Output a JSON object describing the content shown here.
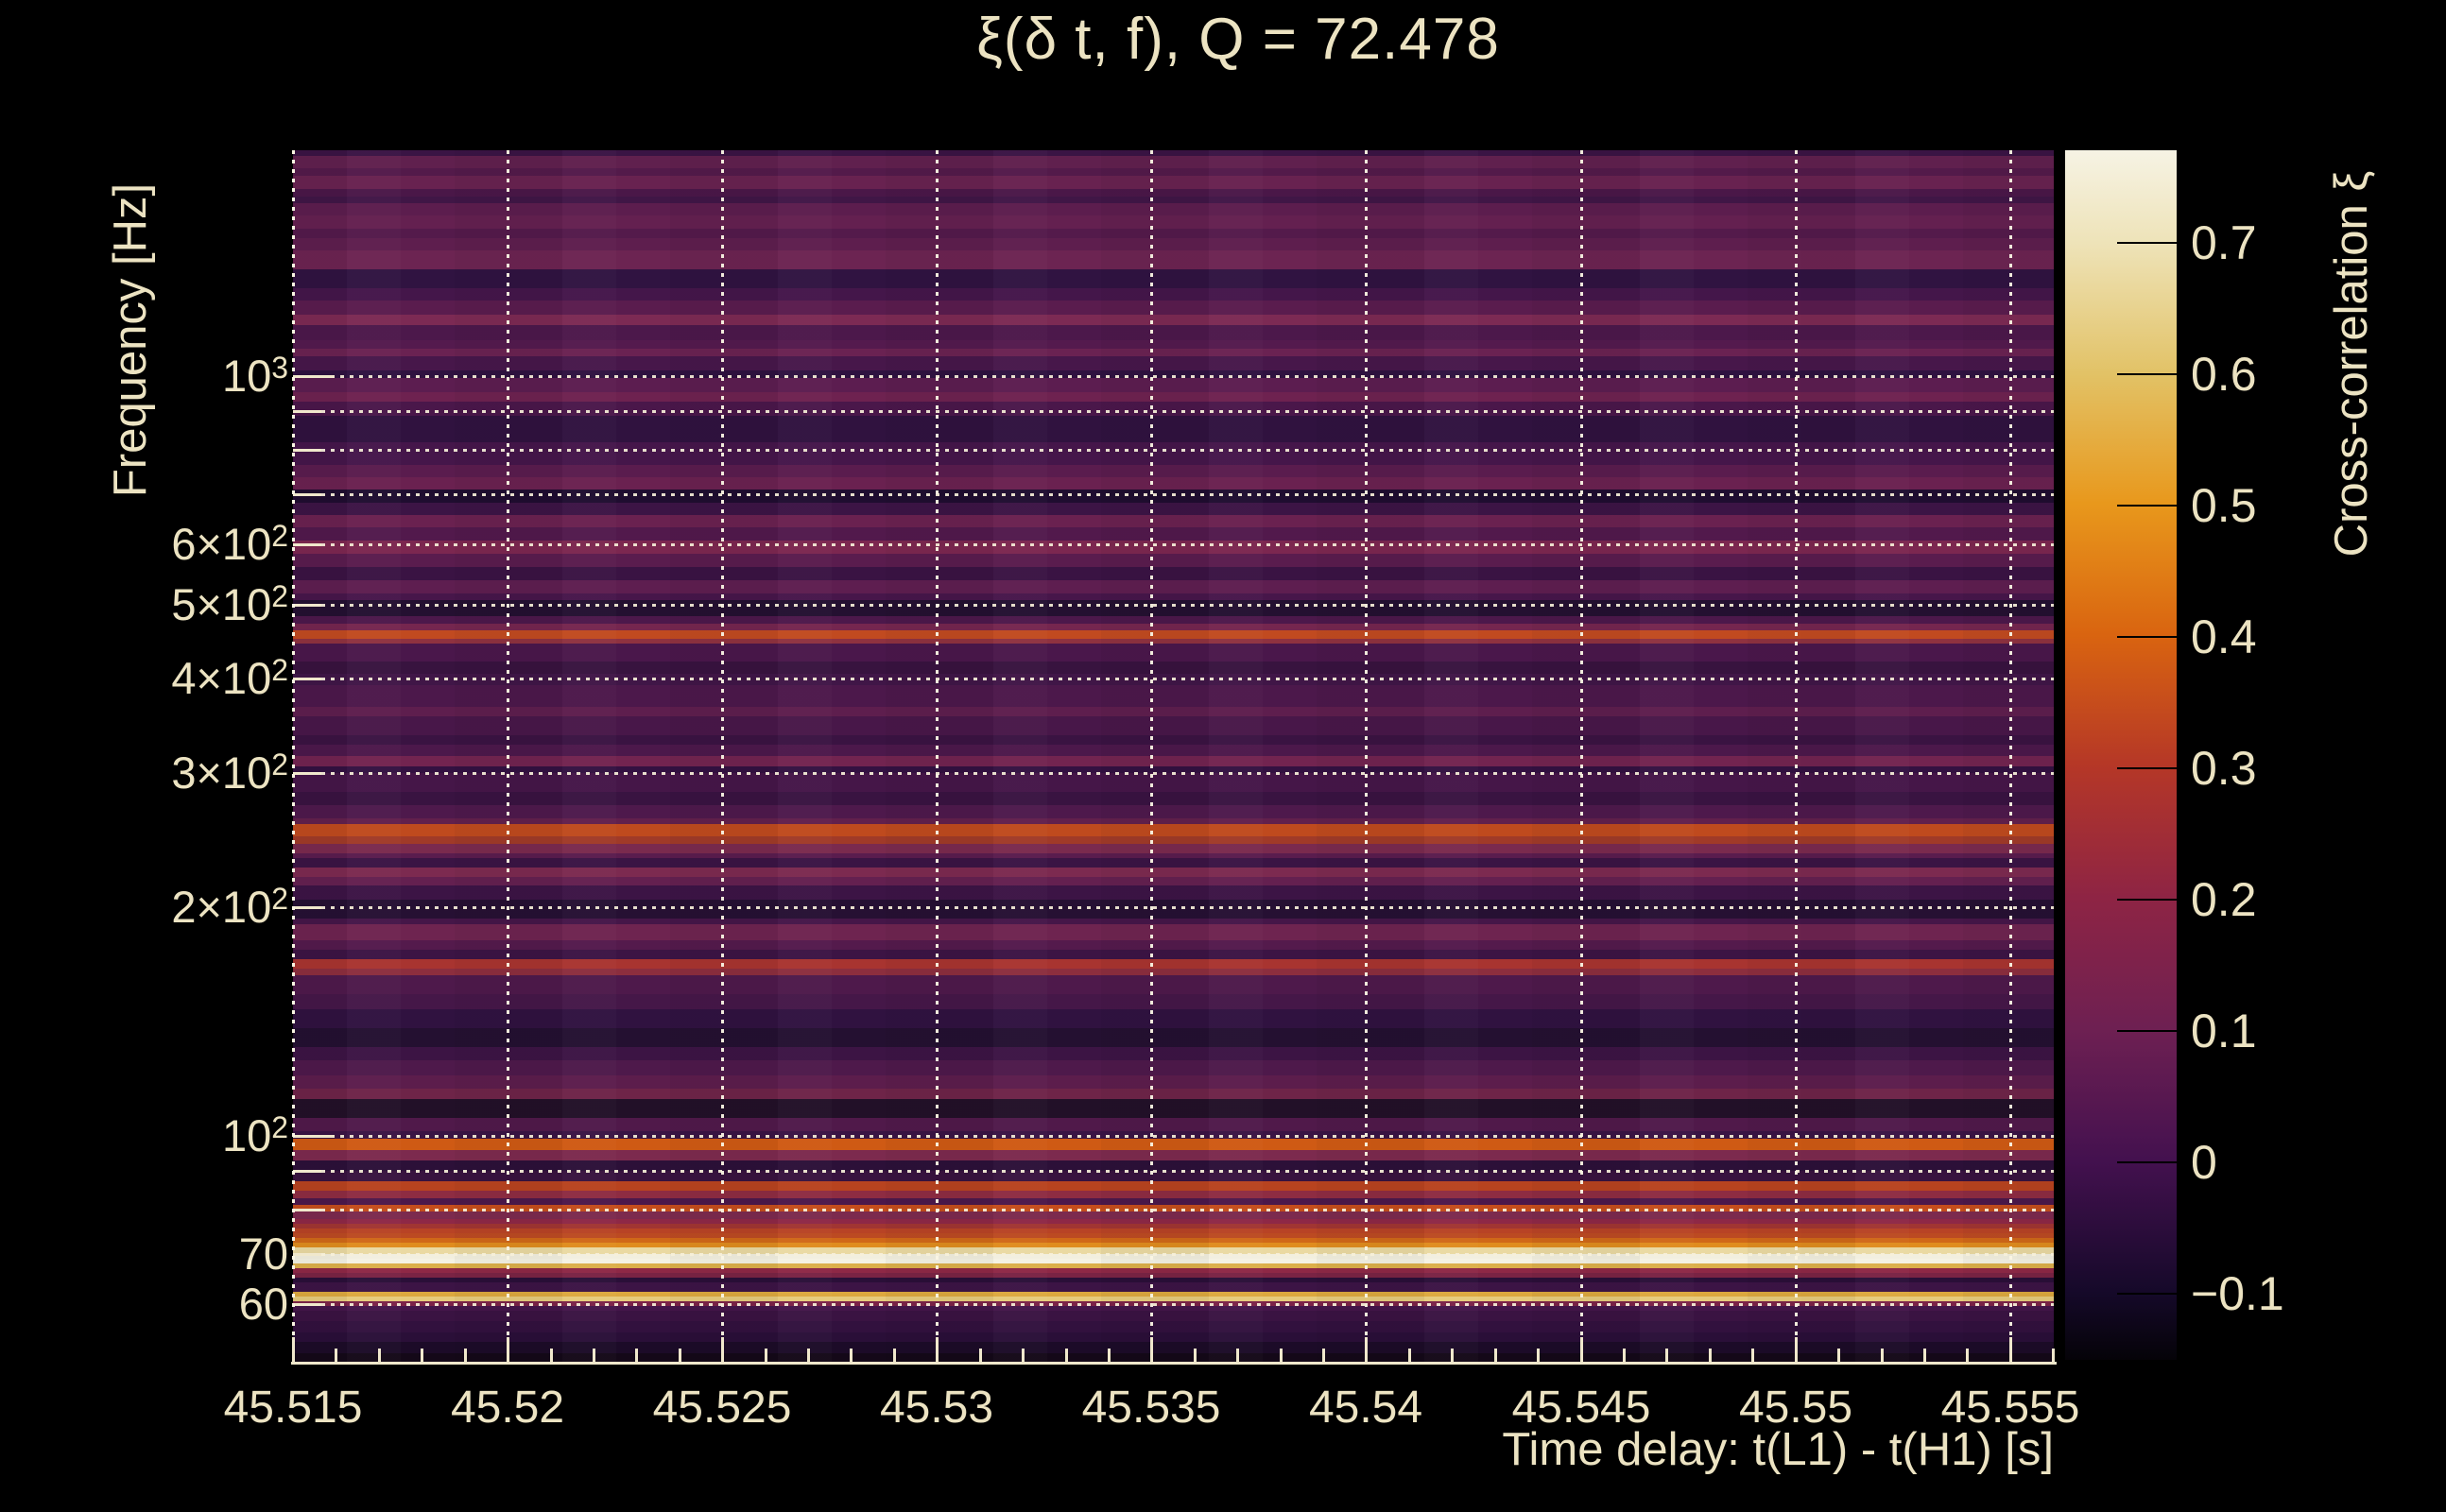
{
  "title": "ξ(δ t, f), Q = 72.478",
  "axes": {
    "x": {
      "title": "Time delay: t(L1) - t(H1) [s]",
      "minor_step_s": 0.001,
      "range_s": [
        45.515,
        45.556
      ],
      "ticks": [
        {
          "t": 45.515,
          "label": "45.515"
        },
        {
          "t": 45.52,
          "label": "45.52"
        },
        {
          "t": 45.525,
          "label": "45.525"
        },
        {
          "t": 45.53,
          "label": "45.53"
        },
        {
          "t": 45.535,
          "label": "45.535"
        },
        {
          "t": 45.54,
          "label": "45.54"
        },
        {
          "t": 45.545,
          "label": "45.545"
        },
        {
          "t": 45.55,
          "label": "45.55"
        },
        {
          "t": 45.555,
          "label": "45.555"
        }
      ]
    },
    "y": {
      "title": "Frequency [Hz]",
      "scale": "log",
      "range_hz": [
        50,
        1983
      ],
      "ticks": [
        {
          "f": 1000,
          "base": "10",
          "exp": "3"
        },
        {
          "f": 600,
          "base": "6×10",
          "exp": "2"
        },
        {
          "f": 500,
          "base": "5×10",
          "exp": "2"
        },
        {
          "f": 400,
          "base": "4×10",
          "exp": "2"
        },
        {
          "f": 300,
          "base": "3×10",
          "exp": "2"
        },
        {
          "f": 200,
          "base": "2×10",
          "exp": "2"
        },
        {
          "f": 100,
          "base": "10",
          "exp": "2"
        },
        {
          "f": 70,
          "base": "70",
          "exp": ""
        },
        {
          "f": 60,
          "base": "60",
          "exp": ""
        }
      ]
    },
    "z": {
      "title": "Cross-correlation ξ",
      "range": [
        -0.15,
        0.77
      ],
      "ticks": [
        {
          "v": 0.7,
          "label": "0.7"
        },
        {
          "v": 0.6,
          "label": "0.6"
        },
        {
          "v": 0.5,
          "label": "0.5"
        },
        {
          "v": 0.4,
          "label": "0.4"
        },
        {
          "v": 0.3,
          "label": "0.3"
        },
        {
          "v": 0.2,
          "label": "0.2"
        },
        {
          "v": 0.1,
          "label": "0.1"
        },
        {
          "v": 0,
          "label": "0"
        },
        {
          "v": -0.1,
          "label": "−0.1"
        }
      ]
    }
  },
  "colors": {
    "background": "#000000",
    "text": "#ece3c2",
    "grid": "#f6efd6",
    "axis": "#f0e8cc",
    "colorbar_tick": "#000000"
  },
  "chart_data": {
    "type": "heatmap",
    "title": "ξ(δ t, f), Q = 72.478",
    "xlabel": "Time delay: t(L1) - t(H1) [s]",
    "ylabel": "Frequency [Hz]",
    "zlabel": "Cross-correlation ξ",
    "x_range_s": [
      45.515,
      45.556
    ],
    "y_range_hz": [
      50,
      1983
    ],
    "y_scale": "log",
    "z_range": [
      -0.15,
      0.77
    ],
    "colormap": "inferno",
    "grid": true,
    "legend_position": "right-colorbar",
    "y_grid_hz": [
      60,
      70,
      80,
      90,
      100,
      200,
      300,
      400,
      500,
      600,
      700,
      800,
      900,
      1000
    ],
    "background_xi_range": [
      -0.1,
      0.2
    ],
    "notable_lines": [
      {
        "f_hz": 61,
        "xi": 0.55
      },
      {
        "f_hz": 62,
        "xi": 0.48
      },
      {
        "f_hz": 70,
        "xi": 0.76
      },
      {
        "f_hz": 75,
        "xi": 0.42
      },
      {
        "f_hz": 80,
        "xi": 0.4
      },
      {
        "f_hz": 86,
        "xi": 0.37
      },
      {
        "f_hz": 97,
        "xi": 0.42
      },
      {
        "f_hz": 170,
        "xi": 0.3
      },
      {
        "f_hz": 250,
        "xi": 0.36
      },
      {
        "f_hz": 460,
        "xi": 0.37
      }
    ],
    "colorbar_stops": [
      [
        0,
        "#050308"
      ],
      [
        5.5,
        "#150929"
      ],
      [
        16.6,
        "#44114f"
      ],
      [
        27.4,
        "#6e2052"
      ],
      [
        38.2,
        "#8e2444"
      ],
      [
        49.1,
        "#b53727"
      ],
      [
        59.9,
        "#d96410"
      ],
      [
        70.8,
        "#e8981c"
      ],
      [
        81.5,
        "#e2c266"
      ],
      [
        92.3,
        "#eee3b8"
      ],
      [
        100,
        "#f6f3e4"
      ]
    ],
    "stripes": [
      [
        6,
        "#3a1444"
      ],
      [
        13,
        "#60204e"
      ],
      [
        8,
        "#531a4a"
      ],
      [
        14,
        "#682250"
      ],
      [
        8,
        "#4a1748"
      ],
      [
        7,
        "#401646"
      ],
      [
        13,
        "#5c1d4e"
      ],
      [
        14,
        "#642050"
      ],
      [
        10,
        "#541a4b"
      ],
      [
        13,
        "#5e1e4e"
      ],
      [
        20,
        "#6c2452"
      ],
      [
        20,
        "#301341"
      ],
      [
        13,
        "#44164a"
      ],
      [
        15,
        "#5a1c4e"
      ],
      [
        11,
        "#7c2a54"
      ],
      [
        16,
        "#4c184b"
      ],
      [
        9,
        "#541a4e"
      ],
      [
        8,
        "#6a2252"
      ],
      [
        15,
        "#47174a"
      ],
      [
        8,
        "#2f1240"
      ],
      [
        15,
        "#5c1d50"
      ],
      [
        10,
        "#6e2250"
      ],
      [
        15,
        "#4a174a"
      ],
      [
        28,
        "#30123f"
      ],
      [
        24,
        "#45164a"
      ],
      [
        13,
        "#5a1c4e"
      ],
      [
        13,
        "#6a2150"
      ],
      [
        14,
        "#1f0d30"
      ],
      [
        13,
        "#3c1445"
      ],
      [
        13,
        "#6a2150"
      ],
      [
        14,
        "#52194c"
      ],
      [
        14,
        "#7c2750"
      ],
      [
        14,
        "#5a1c4e"
      ],
      [
        14,
        "#3a1343"
      ],
      [
        14,
        "#5e1e50"
      ],
      [
        7,
        "#47164a"
      ],
      [
        17,
        "#241031"
      ],
      [
        8,
        "#4c184b"
      ],
      [
        7,
        "#75264f"
      ],
      [
        9,
        "#c14a20"
      ],
      [
        5,
        "#8f3240"
      ],
      [
        19,
        "#4a174b"
      ],
      [
        13,
        "#38133f"
      ],
      [
        12,
        "#401647"
      ],
      [
        23,
        "#4c184b"
      ],
      [
        10,
        "#5e1e4e"
      ],
      [
        20,
        "#481749"
      ],
      [
        10,
        "#3a1342"
      ],
      [
        12,
        "#4c184b"
      ],
      [
        11,
        "#722450"
      ],
      [
        7,
        "#331141"
      ],
      [
        20,
        "#451648"
      ],
      [
        14,
        "#391341"
      ],
      [
        14,
        "#4e194c"
      ],
      [
        6,
        "#62204c"
      ],
      [
        13,
        "#bf4a1e"
      ],
      [
        8,
        "#a03a28"
      ],
      [
        10,
        "#7a2a4e"
      ],
      [
        5,
        "#5a1c4e"
      ],
      [
        10,
        "#3a1444"
      ],
      [
        10,
        "#7c2a50"
      ],
      [
        9,
        "#642050"
      ],
      [
        15,
        "#3c1445"
      ],
      [
        20,
        "#261033"
      ],
      [
        6,
        "#451648"
      ],
      [
        17,
        "#6e2450"
      ],
      [
        10,
        "#541a4c"
      ],
      [
        10,
        "#3c1444"
      ],
      [
        10,
        "#a83430"
      ],
      [
        7,
        "#8c2e3e"
      ],
      [
        20,
        "#4e194b"
      ],
      [
        16,
        "#451748"
      ],
      [
        20,
        "#301240"
      ],
      [
        20,
        "#241031"
      ],
      [
        14,
        "#3c1444"
      ],
      [
        16,
        "#4e194b"
      ],
      [
        14,
        "#5c1d4c"
      ],
      [
        11,
        "#6e2448"
      ],
      [
        20,
        "#221028"
      ],
      [
        14,
        "#50194a"
      ],
      [
        8,
        "#3a1444"
      ],
      [
        12,
        "#cf5a14"
      ],
      [
        11,
        "#7c2a4e"
      ],
      [
        11,
        "#2c1038"
      ],
      [
        11,
        "#38133f"
      ],
      [
        10,
        "#b8431f"
      ],
      [
        8,
        "#8e2c42"
      ],
      [
        7,
        "#4c184b"
      ],
      [
        7,
        "#c44d1d"
      ],
      [
        8,
        "#7c2a4e"
      ],
      [
        5,
        "#8e2846"
      ],
      [
        5,
        "#a13532"
      ],
      [
        5,
        "#b84325"
      ],
      [
        5,
        "#bc4a22"
      ],
      [
        5,
        "#d06818"
      ],
      [
        5,
        "#e08c1e"
      ],
      [
        7,
        "#ead9a2"
      ],
      [
        5,
        "#f2efdf"
      ],
      [
        5,
        "#f5f2e4"
      ],
      [
        5,
        "#dcaf4a"
      ],
      [
        5,
        "#8e2846"
      ],
      [
        5,
        "#7a2344"
      ],
      [
        5,
        "#2a0f38"
      ],
      [
        10,
        "#3c1445"
      ],
      [
        5,
        "#dca83e"
      ],
      [
        5,
        "#e6cb7c"
      ],
      [
        5,
        "#7c2348"
      ],
      [
        5,
        "#44164a"
      ],
      [
        11,
        "#3a1342"
      ],
      [
        12,
        "#32113e"
      ],
      [
        10,
        "#2a0f38"
      ],
      [
        12,
        "#1c0b28"
      ],
      [
        11,
        "#140818"
      ]
    ]
  }
}
